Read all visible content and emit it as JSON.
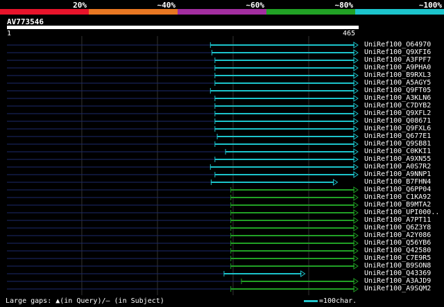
{
  "legend": {
    "labels": [
      "20%",
      "~40%",
      "~60%",
      "~80%",
      "~100%"
    ],
    "colors": [
      "#e8142b",
      "#e87722",
      "#a32ea0",
      "#21a125",
      "#1cc4cc"
    ]
  },
  "query": {
    "name": "AV773546",
    "start": "1",
    "end": "465",
    "length": 465
  },
  "footer": {
    "gaps_text": "Large gaps: ▲(in Query)/– (in Subject)",
    "scale_text": "=100char."
  },
  "chart_data": {
    "type": "alignment",
    "x_range": [
      1,
      465
    ],
    "hits": [
      {
        "name": "UniRef100_O64970",
        "start": 270,
        "end": 465,
        "color": "#1cc4cc"
      },
      {
        "name": "UniRef100_Q9XFI6",
        "start": 272,
        "end": 465,
        "color": "#1cc4cc"
      },
      {
        "name": "UniRef100_A3FPF7",
        "start": 276,
        "end": 465,
        "color": "#1cc4cc"
      },
      {
        "name": "UniRef100_A9PHA0",
        "start": 276,
        "end": 465,
        "color": "#1cc4cc"
      },
      {
        "name": "UniRef100_B9RXL3",
        "start": 276,
        "end": 465,
        "color": "#1cc4cc"
      },
      {
        "name": "UniRef100_A5AGY5",
        "start": 276,
        "end": 465,
        "color": "#1cc4cc"
      },
      {
        "name": "UniRef100_Q9FT05",
        "start": 270,
        "end": 465,
        "color": "#1cc4cc"
      },
      {
        "name": "UniRef100_A3KLN6",
        "start": 276,
        "end": 465,
        "color": "#1cc4cc"
      },
      {
        "name": "UniRef100_C7DYB2",
        "start": 276,
        "end": 465,
        "color": "#1cc4cc"
      },
      {
        "name": "UniRef100_Q9XFL2",
        "start": 276,
        "end": 465,
        "color": "#1cc4cc"
      },
      {
        "name": "UniRef100_Q08671",
        "start": 276,
        "end": 465,
        "color": "#1cc4cc"
      },
      {
        "name": "UniRef100_Q9FXL6",
        "start": 276,
        "end": 465,
        "color": "#1cc4cc"
      },
      {
        "name": "UniRef100_Q677E1",
        "start": 279,
        "end": 465,
        "color": "#1cc4cc"
      },
      {
        "name": "UniRef100_Q9SB81",
        "start": 276,
        "end": 465,
        "color": "#1cc4cc"
      },
      {
        "name": "UniRef100_C0KKI1",
        "start": 290,
        "end": 465,
        "color": "#1cc4cc"
      },
      {
        "name": "UniRef100_A9XN55",
        "start": 276,
        "end": 465,
        "color": "#1cc4cc"
      },
      {
        "name": "UniRef100_A0S7R2",
        "start": 270,
        "end": 465,
        "color": "#1cc4cc"
      },
      {
        "name": "UniRef100_A9NNP1",
        "start": 276,
        "end": 465,
        "color": "#1cc4cc"
      },
      {
        "name": "UniRef100_B7FHN4",
        "start": 271,
        "end": 438,
        "color": "#1cc4cc"
      },
      {
        "name": "UniRef100_Q6PP04",
        "start": 297,
        "end": 465,
        "color": "#21a125"
      },
      {
        "name": "UniRef100_C1KA92",
        "start": 297,
        "end": 465,
        "color": "#21a125"
      },
      {
        "name": "UniRef100_B9MTA2",
        "start": 297,
        "end": 465,
        "color": "#21a125"
      },
      {
        "name": "UniRef100_UPI000..",
        "start": 297,
        "end": 465,
        "color": "#21a125"
      },
      {
        "name": "UniRef100_A7PT11",
        "start": 297,
        "end": 465,
        "color": "#21a125"
      },
      {
        "name": "UniRef100_Q6Z3Y8",
        "start": 297,
        "end": 465,
        "color": "#21a125"
      },
      {
        "name": "UniRef100_A2Y086",
        "start": 297,
        "end": 465,
        "color": "#21a125"
      },
      {
        "name": "UniRef100_Q56YB6",
        "start": 297,
        "end": 465,
        "color": "#21a125"
      },
      {
        "name": "UniRef100_Q42580",
        "start": 297,
        "end": 465,
        "color": "#21a125"
      },
      {
        "name": "UniRef100_C7E9R5",
        "start": 297,
        "end": 465,
        "color": "#21a125"
      },
      {
        "name": "UniRef100_B9SON8",
        "start": 297,
        "end": 465,
        "color": "#21a125"
      },
      {
        "name": "UniRef100_Q43369",
        "start": 288,
        "end": 395,
        "color": "#1cc4cc"
      },
      {
        "name": "UniRef100_A3AJD9",
        "start": 311,
        "end": 465,
        "color": "#21a125"
      },
      {
        "name": "UniRef100_A9SQM2",
        "start": 297,
        "end": 465,
        "color": "#21a125"
      }
    ]
  }
}
